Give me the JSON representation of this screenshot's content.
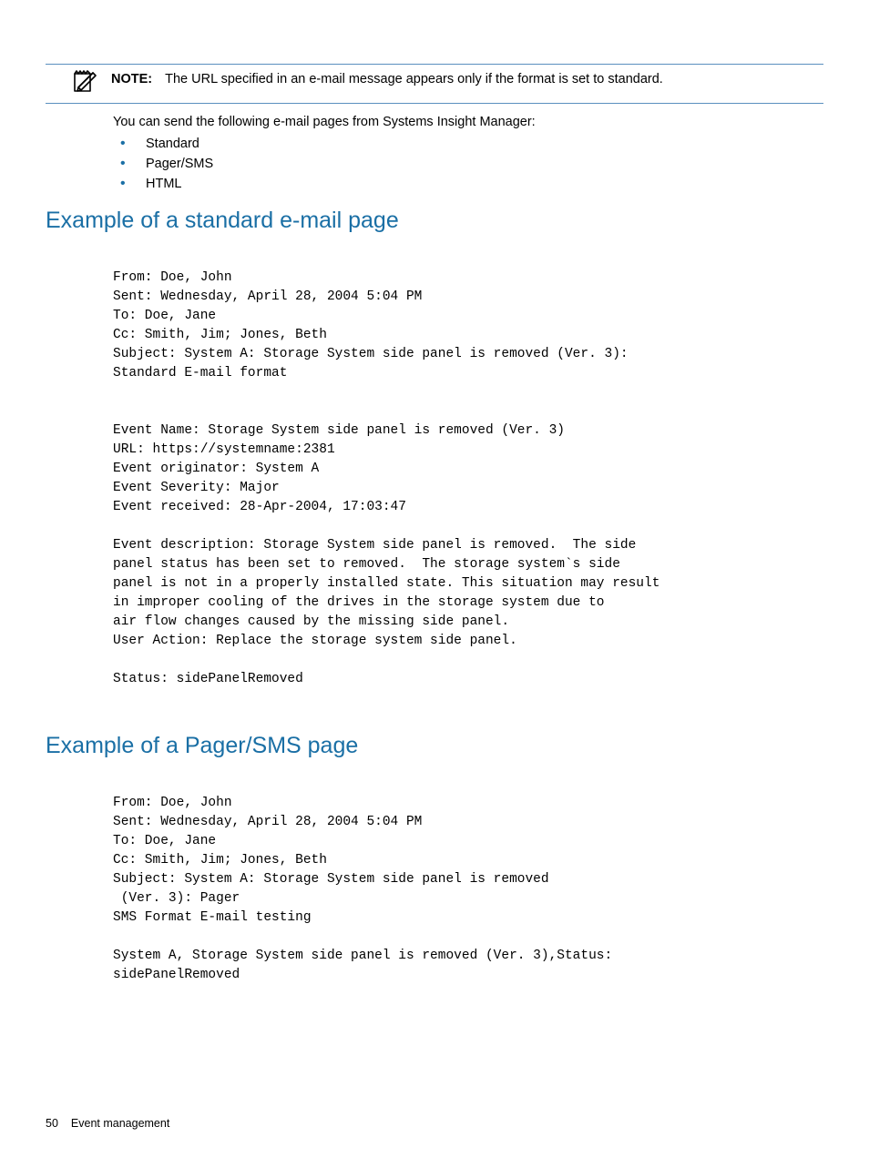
{
  "note": {
    "label": "NOTE:",
    "text": "The URL specified in an e-mail message appears only if the format is set to standard."
  },
  "intro": "You can send the following e-mail pages from Systems Insight Manager:",
  "bullets": [
    "Standard",
    "Pager/SMS",
    "HTML"
  ],
  "section1": {
    "title": "Example of a standard e-mail page",
    "body": "From: Doe, John\nSent: Wednesday, April 28, 2004 5:04 PM\nTo: Doe, Jane\nCc: Smith, Jim; Jones, Beth\nSubject: System A: Storage System side panel is removed (Ver. 3):\nStandard E-mail format\n\n\nEvent Name: Storage System side panel is removed (Ver. 3)\nURL: https://systemname:2381\nEvent originator: System A\nEvent Severity: Major\nEvent received: 28-Apr-2004, 17:03:47\n\nEvent description: Storage System side panel is removed.  The side\npanel status has been set to removed.  The storage system`s side\npanel is not in a properly installed state. This situation may result\nin improper cooling of the drives in the storage system due to\nair flow changes caused by the missing side panel.\nUser Action: Replace the storage system side panel.\n\nStatus: sidePanelRemoved"
  },
  "section2": {
    "title": "Example of a Pager/SMS page",
    "body": "From: Doe, John\nSent: Wednesday, April 28, 2004 5:04 PM\nTo: Doe, Jane\nCc: Smith, Jim; Jones, Beth\nSubject: System A: Storage System side panel is removed\n (Ver. 3): Pager\nSMS Format E-mail testing\n\nSystem A, Storage System side panel is removed (Ver. 3),Status:\nsidePanelRemoved"
  },
  "footer": {
    "page": "50",
    "chapter": "Event management"
  }
}
